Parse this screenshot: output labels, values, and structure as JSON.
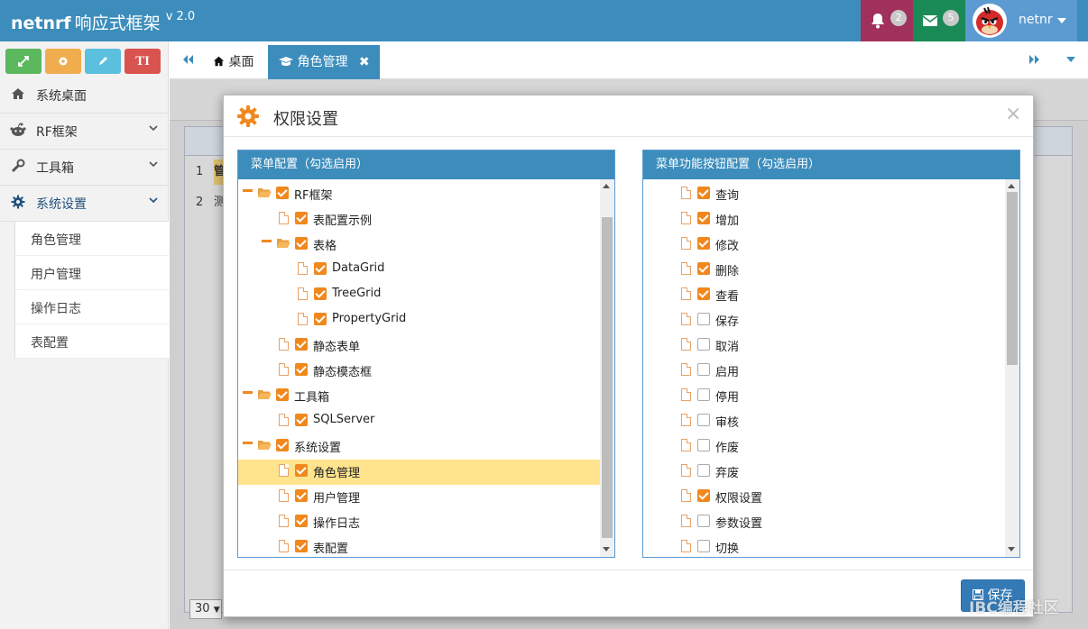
{
  "header": {
    "brand": "netnrf",
    "brand_cn": "响应式框架",
    "version": "v 2.0",
    "notifications_count": "2",
    "messages_count": "5",
    "username": "netnr"
  },
  "sidebar": {
    "tool_buttons": [
      {
        "icon": "expand-icon",
        "color": "#5cb85c"
      },
      {
        "icon": "settings-icon",
        "color": "#f0ad4e"
      },
      {
        "icon": "pencil-icon",
        "color": "#5bc0de"
      },
      {
        "icon": "text-size-icon",
        "label": "TI",
        "color": "#d9534f"
      }
    ],
    "items": [
      {
        "label": "系统桌面",
        "icon": "home-icon"
      },
      {
        "label": "RF框架",
        "icon": "reddit-icon"
      },
      {
        "label": "工具箱",
        "icon": "wrench-icon"
      },
      {
        "label": "系统设置",
        "icon": "gear-icon"
      }
    ],
    "sub_items": [
      "角色管理",
      "用户管理",
      "操作日志",
      "表配置"
    ]
  },
  "tabs": {
    "items": [
      {
        "label": "桌面",
        "icon": "home-icon"
      },
      {
        "label": "角色管理",
        "icon": "graduation-cap-icon"
      }
    ]
  },
  "content": {
    "row_numbers": [
      "1",
      "2"
    ],
    "row_cells": [
      "管",
      "测"
    ],
    "page_size": "30"
  },
  "modal": {
    "title": "权限设置",
    "save_label": "保存",
    "left_panel_title": "菜单配置（勾选启用）",
    "right_panel_title": "菜单功能按钮配置（勾选启用）",
    "menu_tree": [
      {
        "label": "RF框架",
        "level": 0,
        "folder": true,
        "checked": true
      },
      {
        "label": "表配置示例",
        "level": 1,
        "folder": false,
        "checked": true
      },
      {
        "label": "表格",
        "level": 1,
        "folder": true,
        "checked": true
      },
      {
        "label": "DataGrid",
        "level": 2,
        "folder": false,
        "checked": true
      },
      {
        "label": "TreeGrid",
        "level": 2,
        "folder": false,
        "checked": true
      },
      {
        "label": "PropertyGrid",
        "level": 2,
        "folder": false,
        "checked": true
      },
      {
        "label": "静态表单",
        "level": 1,
        "folder": false,
        "checked": true
      },
      {
        "label": "静态模态框",
        "level": 1,
        "folder": false,
        "checked": true
      },
      {
        "label": "工具箱",
        "level": 0,
        "folder": true,
        "checked": true
      },
      {
        "label": "SQLServer",
        "level": 1,
        "folder": false,
        "checked": true
      },
      {
        "label": "系统设置",
        "level": 0,
        "folder": true,
        "checked": true
      },
      {
        "label": "角色管理",
        "level": 1,
        "folder": false,
        "checked": true,
        "selected": true
      },
      {
        "label": "用户管理",
        "level": 1,
        "folder": false,
        "checked": true
      },
      {
        "label": "操作日志",
        "level": 1,
        "folder": false,
        "checked": true
      },
      {
        "label": "表配置",
        "level": 1,
        "folder": false,
        "checked": true
      }
    ],
    "button_list": [
      {
        "label": "查询",
        "checked": true
      },
      {
        "label": "增加",
        "checked": true
      },
      {
        "label": "修改",
        "checked": true
      },
      {
        "label": "删除",
        "checked": true
      },
      {
        "label": "查看",
        "checked": true
      },
      {
        "label": "保存",
        "checked": false
      },
      {
        "label": "取消",
        "checked": false
      },
      {
        "label": "启用",
        "checked": false
      },
      {
        "label": "停用",
        "checked": false
      },
      {
        "label": "审核",
        "checked": false
      },
      {
        "label": "作废",
        "checked": false
      },
      {
        "label": "弃废",
        "checked": false
      },
      {
        "label": "权限设置",
        "checked": true
      },
      {
        "label": "参数设置",
        "checked": false
      },
      {
        "label": "切换",
        "checked": false
      }
    ]
  },
  "watermark": "IBC编程社区",
  "colors": {
    "header": "#3c8dbc",
    "bell_bg": "#a0305c",
    "mail_bg": "#1a8a56",
    "check": "#f0881e",
    "selected_row": "#ffe48d"
  }
}
